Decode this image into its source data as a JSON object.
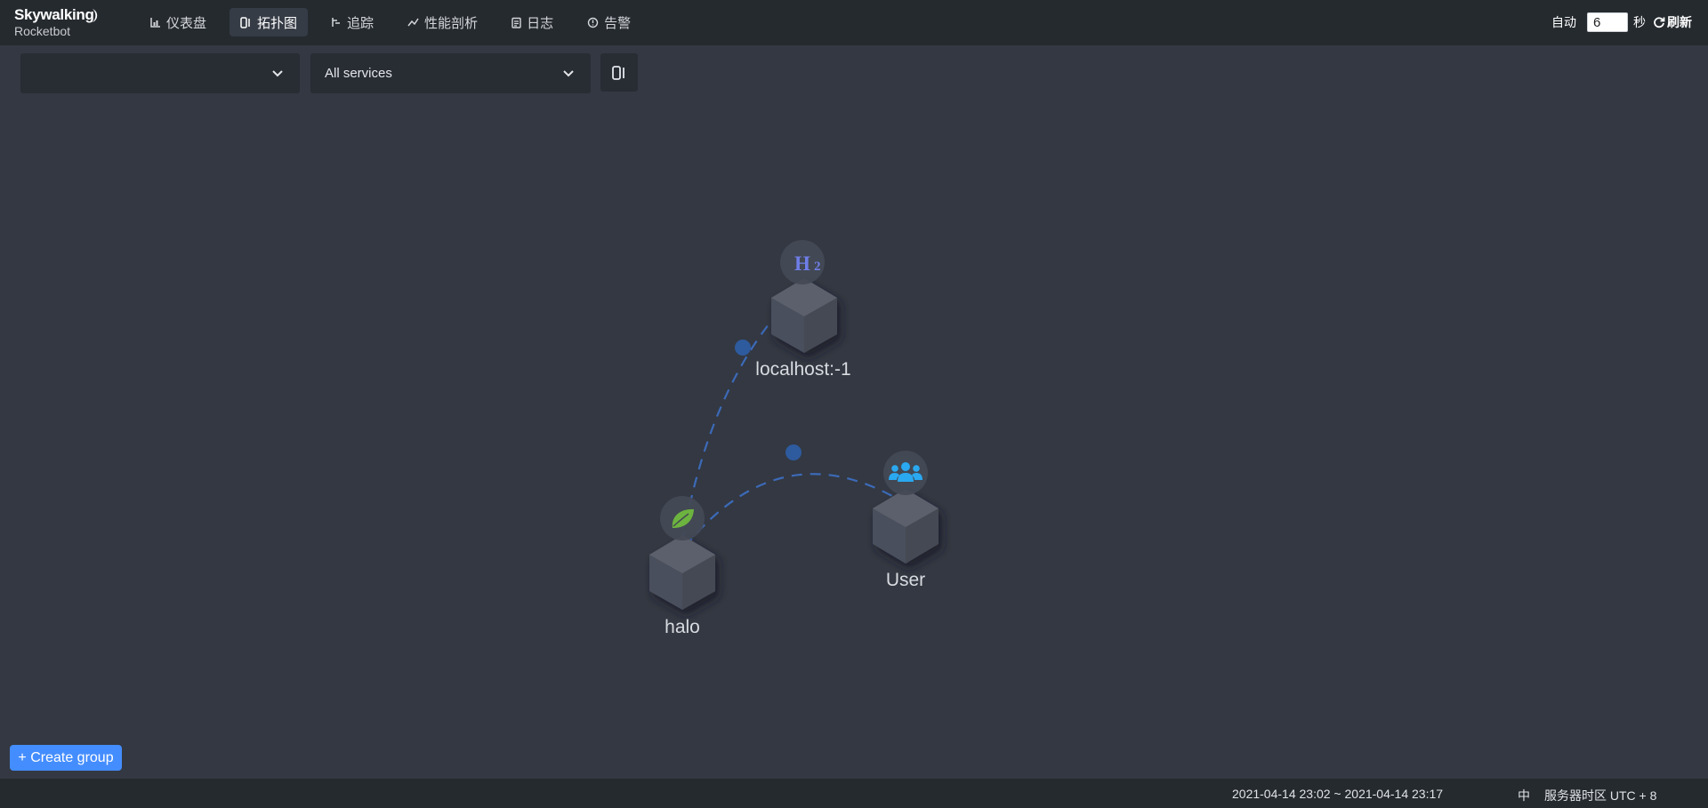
{
  "brand": {
    "name": "Skywalking",
    "sub": "Rocketbot"
  },
  "nav": [
    {
      "label": "仪表盘",
      "icon": "dashboard-icon"
    },
    {
      "label": "拓扑图",
      "icon": "topology-icon",
      "active": true
    },
    {
      "label": "追踪",
      "icon": "trace-icon"
    },
    {
      "label": "性能剖析",
      "icon": "profile-icon"
    },
    {
      "label": "日志",
      "icon": "log-icon"
    },
    {
      "label": "告警",
      "icon": "alarm-icon"
    }
  ],
  "header_right": {
    "auto_label": "自动",
    "interval_value": "6",
    "seconds_label": "秒",
    "refresh_label": "刷新"
  },
  "toolbar": {
    "group_select_value": "",
    "service_select_value": "All services"
  },
  "topology": {
    "nodes": [
      {
        "name": "localhost:-1",
        "type": "H2",
        "badge_text": "H2"
      },
      {
        "name": "halo",
        "type": "spring-boot",
        "badge_icon": "spring-leaf-icon"
      },
      {
        "name": "User",
        "type": "user",
        "badge_icon": "users-icon"
      }
    ],
    "edges": [
      {
        "from": "halo",
        "to": "localhost:-1"
      },
      {
        "from": "User",
        "to": "halo"
      }
    ]
  },
  "create_group_label": "+ Create group",
  "footer": {
    "time_range": "2021-04-14 23:02 ~ 2021-04-14 23:17",
    "language": "中",
    "timezone": "服务器时区 UTC + 8"
  },
  "colors": {
    "background": "#333842",
    "header": "#252a2f",
    "accent": "#448dfe",
    "edge": "#3c6ab8",
    "h2_badge": "#6f7ee8",
    "spring": "#6db33f",
    "user_icon": "#2aa8f0"
  }
}
